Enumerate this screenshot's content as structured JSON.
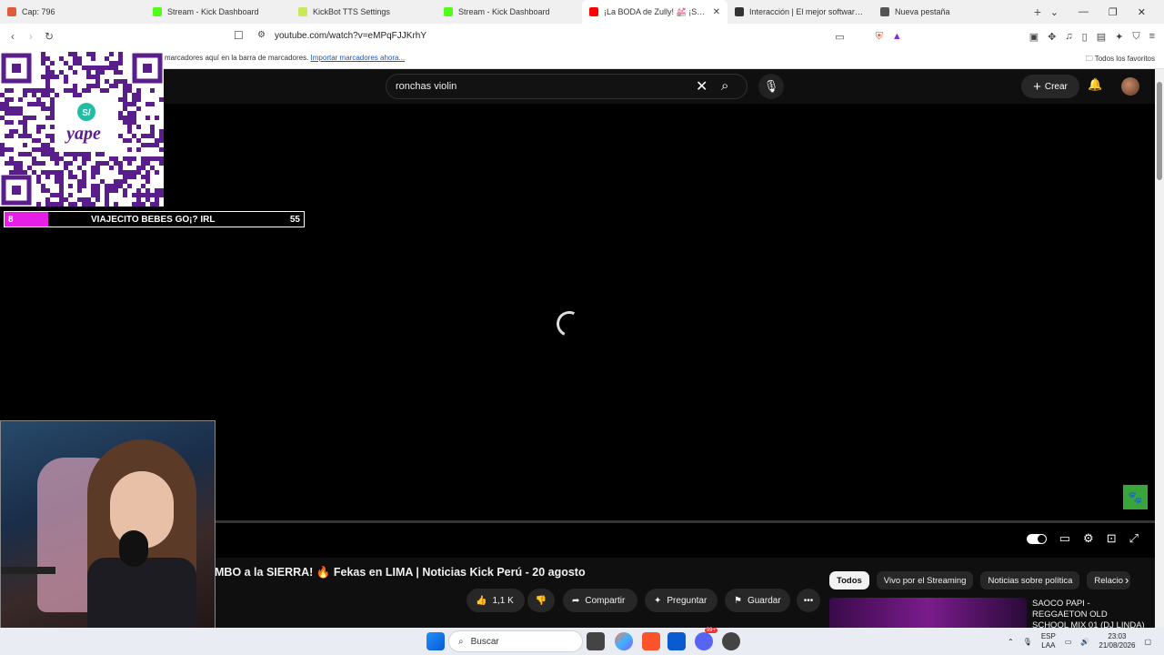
{
  "browser": {
    "tabs": [
      {
        "title": "Cap: 796",
        "favicon_color": "#e05b3a",
        "active": false
      },
      {
        "title": "Stream - Kick Dashboard",
        "favicon_color": "#53fc18",
        "active": false
      },
      {
        "title": "KickBot TTS Settings",
        "favicon_color": "#c9e85a",
        "active": false
      },
      {
        "title": "Stream - Kick Dashboard",
        "favicon_color": "#53fc18",
        "active": false
      },
      {
        "title": "¡La BODA de Zully! 💒 ¡Saco",
        "favicon_color": "#ff0000",
        "active": true
      },
      {
        "title": "Interacción | El mejor software para",
        "favicon_color": "#333333",
        "active": false
      },
      {
        "title": "Nueva pestaña",
        "favicon_color": "#555555",
        "active": false
      }
    ],
    "new_tab": "+",
    "window_controls": {
      "minimize": "—",
      "maximize": "❐",
      "close": "✕"
    },
    "nav": {
      "back": "‹",
      "forward": "›",
      "reload": "↻"
    },
    "url": "youtube.com/watch?v=eMPqFJJKrhY",
    "bookmarks_bar": {
      "message": "marcadores aquí en la barra de marcadores.",
      "import_link": "Importar marcadores ahora...",
      "all_favorites": "Todos los favoritos"
    }
  },
  "youtube": {
    "search_value": "ronchas violin",
    "create_label": "Crear",
    "video_title": "MBO a la SIERRA! 🔥 Fekas en LIMA | Noticias Kick Perú - 20 agosto",
    "actions": {
      "likes": "1,1 K",
      "share": "Compartir",
      "ask": "Preguntar",
      "save": "Guardar",
      "more": "•••"
    },
    "chips": [
      "Todos",
      "Vivo por el Streaming",
      "Noticias sobre política",
      "Relacio"
    ],
    "recommended": {
      "title": "SAOCO PAPI - REGGAETON OLD SCHOOL MIX 01 (DJ LINDA)"
    }
  },
  "overlay": {
    "goal": {
      "current": "8",
      "label": "VIAJECITO BEBES GO¡? IRL",
      "target": "55",
      "progress": 0.145,
      "fill_color": "#e61fe6"
    },
    "qr_brand": "yape",
    "qr_symbol": "S/"
  },
  "taskbar": {
    "search_placeholder": "Buscar",
    "lang_top": "ESP",
    "lang_bottom": "LAA",
    "time": "23:03",
    "date": "21/08/2026",
    "discord_badge": "99+"
  }
}
